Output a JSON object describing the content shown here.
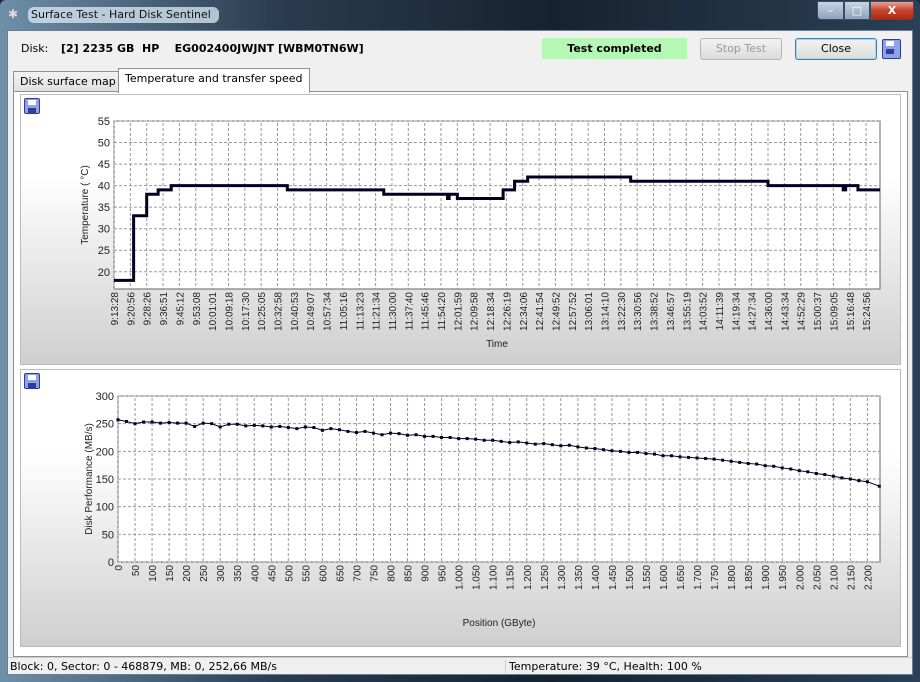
{
  "window": {
    "title": "Surface Test - Hard Disk Sentinel",
    "min": "–",
    "max": "□",
    "close": "X"
  },
  "header": {
    "disk_label": "Disk:",
    "disk_value": "[2] 2235 GB  HP    EG002400JWJNT [WBM0TN6W]",
    "status": "Test completed",
    "stop_button": "Stop Test",
    "close_button": "Close"
  },
  "tabs": [
    {
      "label": "Disk surface map"
    },
    {
      "label": "Temperature and transfer speed"
    }
  ],
  "statusbar": {
    "left": "Block: 0, Sector: 0 - 468879, MB: 0, 252,66 MB/s",
    "right": "Temperature: 39  °C,  Health: 100 %"
  },
  "chart_data": [
    {
      "type": "line",
      "title": "",
      "xlabel": "Time",
      "ylabel": "Temperature ( °C)",
      "ylim": [
        16,
        55
      ],
      "yticks": [
        20,
        25,
        30,
        35,
        40,
        45,
        50,
        55
      ],
      "grid": true,
      "x_labels": [
        "9:13:28",
        "9:20:56",
        "9:28:26",
        "9:36:51",
        "9:45:12",
        "9:53:08",
        "10:01:01",
        "10:09:18",
        "10:17:30",
        "10:25:05",
        "10:32:58",
        "10:40:53",
        "10:49:07",
        "10:57:34",
        "11:05:16",
        "11:13:23",
        "11:21:34",
        "11:30:00",
        "11:37:40",
        "11:45:46",
        "11:54:20",
        "12:01:59",
        "12:09:58",
        "12:18:34",
        "12:26:19",
        "12:34:06",
        "12:41:54",
        "12:49:52",
        "12:57:52",
        "13:06:01",
        "13:14:10",
        "13:22:30",
        "13:30:56",
        "13:38:52",
        "13:46:57",
        "13:55:19",
        "14:03:52",
        "14:11:39",
        "14:19:34",
        "14:27:34",
        "14:36:00",
        "14:43:34",
        "14:52:29",
        "15:00:37",
        "15:09:05",
        "15:16:48",
        "15:24:56"
      ],
      "steps": [
        [
          0,
          18
        ],
        [
          1.2,
          33
        ],
        [
          2.0,
          38
        ],
        [
          2.7,
          39
        ],
        [
          3.5,
          40
        ],
        [
          10.6,
          39
        ],
        [
          16.5,
          38
        ],
        [
          20.4,
          37
        ],
        [
          20.5,
          38
        ],
        [
          21.0,
          37
        ],
        [
          23.8,
          39
        ],
        [
          24.5,
          41
        ],
        [
          25.3,
          42
        ],
        [
          31.6,
          41
        ],
        [
          40.0,
          40
        ],
        [
          44.6,
          39
        ],
        [
          44.75,
          40
        ],
        [
          45.5,
          39
        ],
        [
          46.85,
          39
        ]
      ],
      "line_color": "#000020"
    },
    {
      "type": "scatter",
      "title": "",
      "xlabel": "Position (GByte)",
      "ylabel": "Disk Performance (MB/s)",
      "xlim": [
        0,
        2237
      ],
      "ylim": [
        0,
        300
      ],
      "yticks": [
        0,
        50,
        100,
        150,
        200,
        250,
        300
      ],
      "grid": true,
      "x_tick_labels": [
        "0",
        "50",
        "100",
        "150",
        "200",
        "250",
        "300",
        "350",
        "400",
        "450",
        "500",
        "550",
        "600",
        "650",
        "700",
        "750",
        "800",
        "850",
        "900",
        "950",
        "1.000",
        "1.050",
        "1.100",
        "1.150",
        "1.200",
        "1.250",
        "1.300",
        "1.350",
        "1.400",
        "1.450",
        "1.500",
        "1.550",
        "1.600",
        "1.650",
        "1.700",
        "1.750",
        "1.800",
        "1.850",
        "1.900",
        "1.950",
        "2.000",
        "2.050",
        "2.100",
        "2.150",
        "2.200"
      ],
      "x": [
        0,
        25,
        50,
        75,
        100,
        125,
        150,
        175,
        200,
        225,
        250,
        275,
        300,
        325,
        350,
        375,
        400,
        425,
        450,
        475,
        500,
        525,
        550,
        575,
        600,
        625,
        650,
        675,
        700,
        725,
        750,
        775,
        800,
        825,
        850,
        875,
        900,
        925,
        950,
        975,
        1000,
        1025,
        1050,
        1075,
        1100,
        1125,
        1150,
        1175,
        1200,
        1225,
        1250,
        1275,
        1300,
        1325,
        1350,
        1375,
        1400,
        1425,
        1450,
        1475,
        1500,
        1525,
        1550,
        1575,
        1600,
        1625,
        1650,
        1675,
        1700,
        1725,
        1750,
        1775,
        1800,
        1825,
        1850,
        1875,
        1900,
        1925,
        1950,
        1975,
        2000,
        2025,
        2050,
        2075,
        2100,
        2125,
        2150,
        2175,
        2200,
        2235
      ],
      "y": [
        257,
        254,
        250,
        253,
        253,
        251,
        252,
        251,
        251,
        245,
        251,
        250,
        244,
        249,
        249,
        246,
        247,
        246,
        244,
        245,
        243,
        241,
        244,
        243,
        238,
        241,
        239,
        236,
        234,
        236,
        233,
        230,
        233,
        232,
        229,
        230,
        227,
        227,
        225,
        225,
        223,
        223,
        222,
        220,
        220,
        218,
        216,
        217,
        215,
        213,
        214,
        212,
        210,
        211,
        208,
        206,
        205,
        203,
        201,
        200,
        198,
        198,
        196,
        195,
        192,
        192,
        190,
        189,
        188,
        187,
        186,
        184,
        182,
        180,
        178,
        177,
        174,
        173,
        170,
        168,
        165,
        163,
        160,
        158,
        155,
        152,
        150,
        147,
        145,
        137
      ],
      "point_color": "#000020"
    }
  ]
}
